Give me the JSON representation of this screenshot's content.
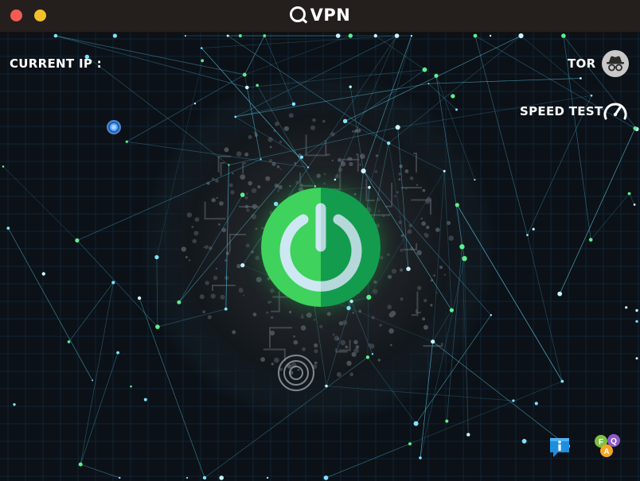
{
  "window": {
    "title": "VPN",
    "controls": [
      "close",
      "minimize"
    ]
  },
  "labels": {
    "current_ip": "CURRENT IP :",
    "tor": "TOR",
    "speed_test": "SPEED TEST"
  },
  "icons": {
    "app_logo": "search-q-icon",
    "tor": "incognito-icon",
    "speed_test": "speedometer-icon",
    "power": "power-icon",
    "info": "info-bubble-icon",
    "faq": "faq-icon"
  },
  "faq_letters": {
    "f": "F",
    "a": "A",
    "q": "Q"
  },
  "status": {
    "connected": true
  },
  "colors": {
    "power_light": "#3fd25c",
    "power_dark": "#14a351",
    "power_ring": "#cde8f2",
    "titlebar": "#241f1c",
    "close": "#f25c54",
    "minimize": "#f5bf2c",
    "info_blue": "#1e8fe0",
    "tor_bg": "#c9c9c9"
  }
}
